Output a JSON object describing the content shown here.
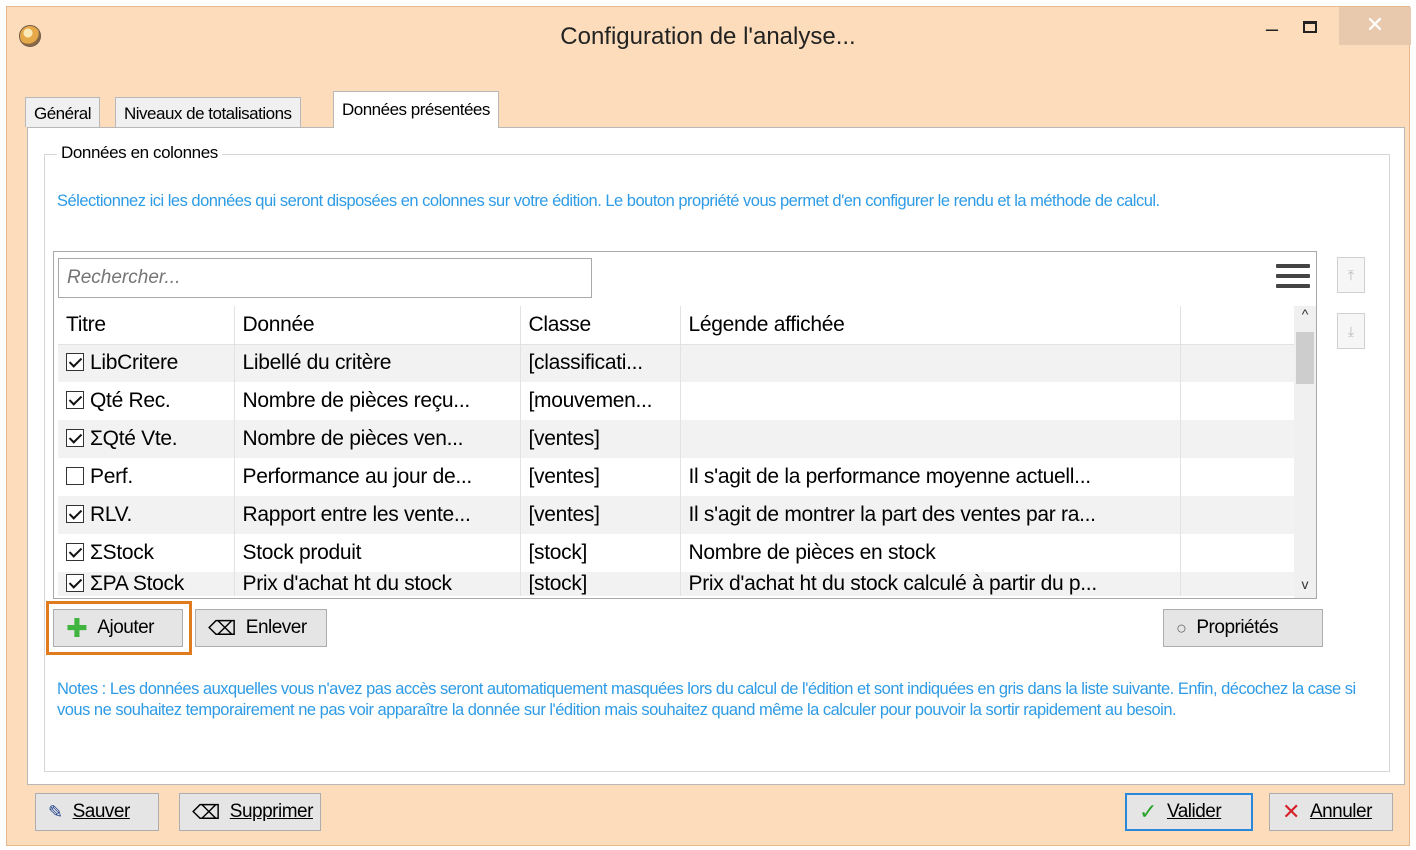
{
  "window": {
    "title": "Configuration de l'analyse...",
    "min_label": "–",
    "close_label": "✕"
  },
  "tabs": [
    {
      "label": "Général",
      "active": false
    },
    {
      "label": "Niveaux de totalisations",
      "active": false
    },
    {
      "label": "Données présentées",
      "active": true
    }
  ],
  "group": {
    "legend": "Données en colonnes",
    "info": "Sélectionnez ici les données qui seront disposées en colonnes sur votre édition. Le bouton propriété vous permet d'en configurer le rendu et la méthode de calcul."
  },
  "search": {
    "placeholder": "Rechercher..."
  },
  "table": {
    "columns": [
      "Titre",
      "Donnée",
      "Classe",
      "Légende affichée"
    ],
    "rows": [
      {
        "checked": true,
        "titre": "LibCritere",
        "donnee": "Libellé du critère",
        "classe": "[classificati...",
        "legende": ""
      },
      {
        "checked": true,
        "titre": "Qté Rec.",
        "donnee": "Nombre de pièces reçu...",
        "classe": "[mouvemen...",
        "legende": ""
      },
      {
        "checked": true,
        "titre": "ΣQté Vte.",
        "donnee": "Nombre de pièces ven...",
        "classe": "[ventes]",
        "legende": ""
      },
      {
        "checked": false,
        "titre": "Perf.",
        "donnee": "Performance au jour de...",
        "classe": "[ventes]",
        "legende": "Il s'agit de la performance moyenne actuell..."
      },
      {
        "checked": true,
        "titre": "RLV.",
        "donnee": "Rapport entre les vente...",
        "classe": "[ventes]",
        "legende": "Il s'agit de montrer la part des ventes par ra..."
      },
      {
        "checked": true,
        "titre": "ΣStock",
        "donnee": "Stock produit",
        "classe": "[stock]",
        "legende": "Nombre de pièces en stock"
      },
      {
        "checked": true,
        "titre": "ΣPA Stock",
        "donnee": "Prix d'achat ht du stock",
        "classe": "[stock]",
        "legende": "Prix d'achat ht du stock calculé à partir du p..."
      }
    ]
  },
  "actions": {
    "add": "Ajouter",
    "remove": "Enlever",
    "properties": "Propriétés"
  },
  "notes": "Notes : Les données auxquelles vous n'avez pas accès seront automatiquement masquées lors du calcul de l'édition et sont indiquées en gris dans la liste suivante. Enfin, décochez la case si vous ne souhaitez temporairement ne pas voir apparaître la donnée sur l'édition mais souhaitez quand même la calculer pour pouvoir la sortir rapidement au besoin.",
  "footer": {
    "save": "Sauver",
    "delete": "Supprimer",
    "validate": "Valider",
    "cancel": "Annuler"
  },
  "colors": {
    "window_bg": "#fcdcba",
    "info_text": "#2e9be6",
    "highlight": "#e07b1e",
    "add_icon": "#3fb43f",
    "validate_icon": "#2aa52a",
    "cancel_icon": "#d6202a"
  }
}
